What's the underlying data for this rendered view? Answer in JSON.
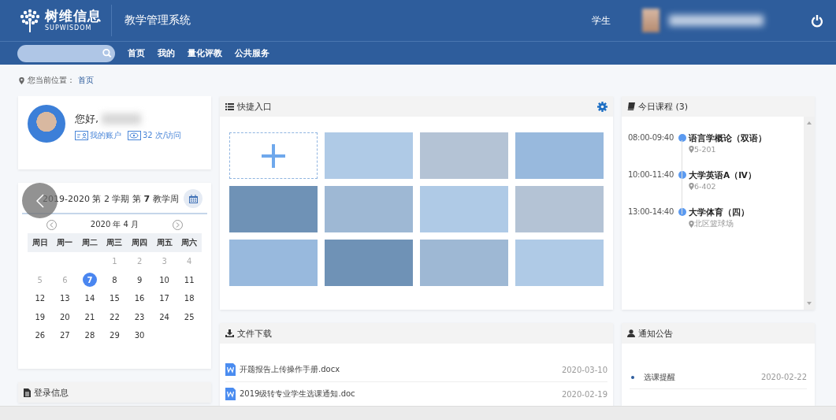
{
  "header": {
    "logo_cn": "树维信息",
    "logo_en": "SUPWISDOM",
    "system_title": "教学管理系统",
    "role": "学生"
  },
  "nav": {
    "items": [
      {
        "label": "首页"
      },
      {
        "label": "我的"
      },
      {
        "label": "量化评教"
      },
      {
        "label": "公共服务"
      }
    ]
  },
  "breadcrumb": {
    "label": "您当前位置：",
    "current": "首页"
  },
  "profile": {
    "greeting": "您好,",
    "links": [
      {
        "kind": "account",
        "label": "我的账户"
      },
      {
        "kind": "visits",
        "label": "32 次/访问"
      }
    ]
  },
  "calendar": {
    "term": "2019-2020 第 2 学期  第 **7** 教学周",
    "month": "2020 年 4 月",
    "weekdays": [
      "周日",
      "周一",
      "周二",
      "周三",
      "周四",
      "周五",
      "周六"
    ],
    "weeks": [
      {
        "starts_midweek": true,
        "days": [
          {
            "day": "1",
            "muted": true,
            "selected": false
          },
          {
            "day": "2",
            "muted": true,
            "selected": false
          },
          {
            "day": "3",
            "muted": true,
            "selected": false
          },
          {
            "day": "4",
            "muted": true,
            "selected": false
          }
        ]
      },
      {
        "days": [
          {
            "day": "5",
            "muted": true,
            "selected": false
          },
          {
            "day": "6",
            "muted": true,
            "selected": false
          },
          {
            "day": "7",
            "muted": false,
            "selected": true
          },
          {
            "day": "8",
            "muted": false,
            "selected": false
          },
          {
            "day": "9",
            "muted": false,
            "selected": false
          },
          {
            "day": "10",
            "muted": false,
            "selected": false
          },
          {
            "day": "11",
            "muted": false,
            "selected": false
          }
        ]
      },
      {
        "days": [
          {
            "day": "12",
            "muted": false,
            "selected": false
          },
          {
            "day": "13",
            "muted": false,
            "selected": false
          },
          {
            "day": "14",
            "muted": false,
            "selected": false
          },
          {
            "day": "15",
            "muted": false,
            "selected": false
          },
          {
            "day": "16",
            "muted": false,
            "selected": false
          },
          {
            "day": "17",
            "muted": false,
            "selected": false
          },
          {
            "day": "18",
            "muted": false,
            "selected": false
          }
        ]
      },
      {
        "days": [
          {
            "day": "19",
            "muted": false,
            "selected": false
          },
          {
            "day": "20",
            "muted": false,
            "selected": false
          },
          {
            "day": "21",
            "muted": false,
            "selected": false
          },
          {
            "day": "22",
            "muted": false,
            "selected": false
          },
          {
            "day": "23",
            "muted": false,
            "selected": false
          },
          {
            "day": "24",
            "muted": false,
            "selected": false
          },
          {
            "day": "25",
            "muted": false,
            "selected": false
          }
        ]
      },
      {
        "starts_midweek": false,
        "days": [
          {
            "day": "26",
            "muted": false,
            "selected": false
          },
          {
            "day": "27",
            "muted": false,
            "selected": false
          },
          {
            "day": "28",
            "muted": false,
            "selected": false
          },
          {
            "day": "29",
            "muted": false,
            "selected": false
          },
          {
            "day": "30",
            "muted": false,
            "selected": false
          }
        ]
      }
    ]
  },
  "login_info": {
    "title": "登录信息"
  },
  "quick_entry": {
    "title": "快捷入口",
    "tiles": [
      {
        "kind": "add"
      },
      {
        "kind": "tile",
        "color": "#afcae6"
      },
      {
        "kind": "tile",
        "color": "#b4c3d5"
      },
      {
        "kind": "tile",
        "color": "#98b9dd"
      },
      {
        "kind": "tile",
        "color": "#6f92b6"
      },
      {
        "kind": "tile",
        "color": "#9eb8d4"
      },
      {
        "kind": "tile",
        "color": "#afcae6"
      },
      {
        "kind": "tile",
        "color": "#b4c3d5"
      },
      {
        "kind": "tile",
        "color": "#98b9dd"
      },
      {
        "kind": "tile",
        "color": "#6f92b6"
      },
      {
        "kind": "tile",
        "color": "#9eb8d4"
      },
      {
        "kind": "tile",
        "color": "#afcae6"
      }
    ]
  },
  "files": {
    "title": "文件下载",
    "items": [
      {
        "name": "开题报告上传操作手册.docx",
        "date": "2020-03-10"
      },
      {
        "name": "2019级转专业学生选课通知.doc",
        "date": "2020-02-19"
      }
    ]
  },
  "courses": {
    "title": "今日课程 (3)",
    "items": [
      {
        "time": "08:00-09:40",
        "name": "语言学概论（双语）",
        "place": "5-201"
      },
      {
        "time": "10:00-11:40",
        "name": "大学英语A（Ⅳ）",
        "place": "6-402"
      },
      {
        "time": "13:00-14:40",
        "name": "大学体育（四）",
        "place": "北区篮球场"
      }
    ]
  },
  "notices": {
    "title": "通知公告",
    "items": [
      {
        "title": "选课提醒",
        "date": "2020-02-22"
      }
    ]
  }
}
